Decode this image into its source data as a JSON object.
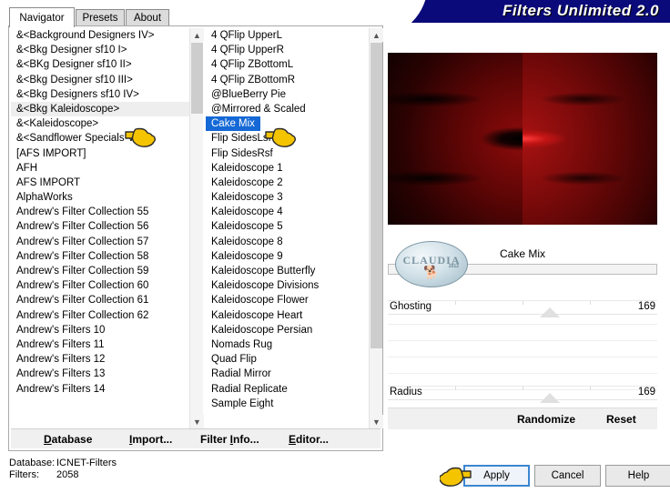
{
  "banner": {
    "title": "Filters Unlimited 2.0"
  },
  "tabs": [
    {
      "label": "Navigator",
      "active": true
    },
    {
      "label": "Presets",
      "active": false
    },
    {
      "label": "About",
      "active": false
    }
  ],
  "categories": {
    "selected": "&<Bkg Kaleidoscope>",
    "items": [
      "&<Background Designers IV>",
      "&<Bkg Designer sf10 I>",
      "&<BKg Designer sf10 II>",
      "&<Bkg Designer sf10 III>",
      "&<Bkg Designers sf10 IV>",
      "&<Bkg Kaleidoscope>",
      "&<Kaleidoscope>",
      "&<Sandflower Specials°v° >",
      "[AFS IMPORT]",
      "AFH",
      "AFS IMPORT",
      "AlphaWorks",
      "Andrew's Filter Collection 55",
      "Andrew's Filter Collection 56",
      "Andrew's Filter Collection 57",
      "Andrew's Filter Collection 58",
      "Andrew's Filter Collection 59",
      "Andrew's Filter Collection 60",
      "Andrew's Filter Collection 61",
      "Andrew's Filter Collection 62",
      "Andrew's Filters 10",
      "Andrew's Filters 11",
      "Andrew's Filters 12",
      "Andrew's Filters 13",
      "Andrew's Filters 14"
    ]
  },
  "effects": {
    "selected": "Cake Mix",
    "items": [
      "4 QFlip UpperL",
      "4 QFlip UpperR",
      "4 QFlip ZBottomL",
      "4 QFlip ZBottomR",
      "@BlueBerry Pie",
      "@Mirrored & Scaled",
      "Cake Mix",
      "Flip SidesLsf",
      "Flip SidesRsf",
      "Kaleidoscope 1",
      "Kaleidoscope 2",
      "Kaleidoscope 3",
      "Kaleidoscope 4",
      "Kaleidoscope 5",
      "Kaleidoscope 8",
      "Kaleidoscope 9",
      "Kaleidoscope Butterfly",
      "Kaleidoscope Divisions",
      "Kaleidoscope Flower",
      "Kaleidoscope Heart",
      "Kaleidoscope Persian",
      "Nomads Rug",
      "Quad Flip",
      "Radial Mirror",
      "Radial Replicate",
      "Sample Eight"
    ]
  },
  "panel_actions": {
    "database": "Database",
    "import": "Import...",
    "filter_info": "Filter Info...",
    "editor": "Editor..."
  },
  "parameters": {
    "title": "Cake Mix",
    "watermark": {
      "text": "CLAUDIA",
      "sub": "2012",
      "figure": "dog-figure"
    },
    "sliders": [
      {
        "label": "Ghosting",
        "value": "169",
        "position_pct": 60
      },
      {
        "label": "Radius",
        "value": "169",
        "position_pct": 60
      }
    ],
    "randomize": "Randomize",
    "reset": "Reset"
  },
  "status": {
    "database_key": "Database:",
    "database_value": "ICNET-Filters",
    "filters_key": "Filters:",
    "filters_value": "2058"
  },
  "dialog_buttons": {
    "apply": "Apply",
    "cancel": "Cancel",
    "help": "Help"
  },
  "colors": {
    "banner_bg": "#0a0a7a",
    "selection_blue": "#1569d6",
    "focus_blue": "#3b86d0",
    "cursor_yellow": "#f5c400"
  },
  "cursors": [
    {
      "name": "hand-cursor-category",
      "target": "&<Bkg Kaleidoscope>"
    },
    {
      "name": "hand-cursor-effect",
      "target": "Cake Mix"
    },
    {
      "name": "hand-cursor-apply",
      "target": "Apply"
    }
  ]
}
